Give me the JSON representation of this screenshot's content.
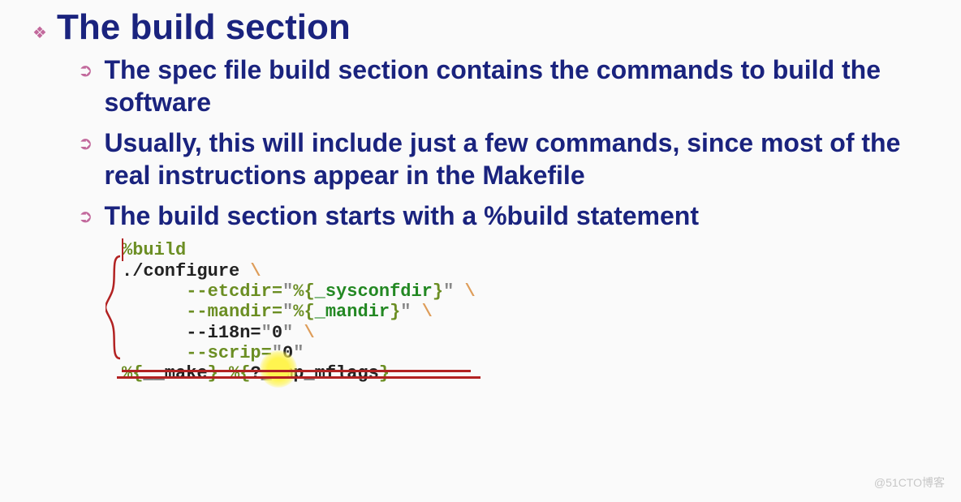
{
  "title": "The build section",
  "bullets": [
    "The spec file build section contains the commands to build the software",
    "Usually, this will include just a few commands, since most of the real instructions appear in the Makefile",
    "The build section starts with a %build statement"
  ],
  "code": {
    "line1": "%build",
    "line2_cmd": "./configure",
    "line2_bs": " \\",
    "line3_flag": "--etcdir=",
    "line3_q1": "\"",
    "line3_macro_open": "%{",
    "line3_macro_name": "_sysconfdir",
    "line3_macro_close": "}",
    "line3_q2": "\"",
    "line3_bs": " \\",
    "line4_flag": "--mandir=",
    "line4_q1": "\"",
    "line4_macro_open": "%{",
    "line4_macro_name": "_mandir",
    "line4_macro_close": "}",
    "line4_q2": "\"",
    "line4_bs": " \\",
    "line5_flag": "--i18n=",
    "line5_q1": "\"",
    "line5_val": "0",
    "line5_q2": "\"",
    "line5_bs": " \\",
    "line6_flag": "--scrip=",
    "line6_q1": "\"",
    "line6_val": "0",
    "line6_q2": "\"",
    "line7_m1_open": "%{",
    "line7_m1_name": "__make",
    "line7_m1_close": "}",
    "line7_sep": " ",
    "line7_m2_open": "%{",
    "line7_m2_name": "?_smp_mflags",
    "line7_m2_close": "}"
  },
  "watermark": "@51CTO博客"
}
